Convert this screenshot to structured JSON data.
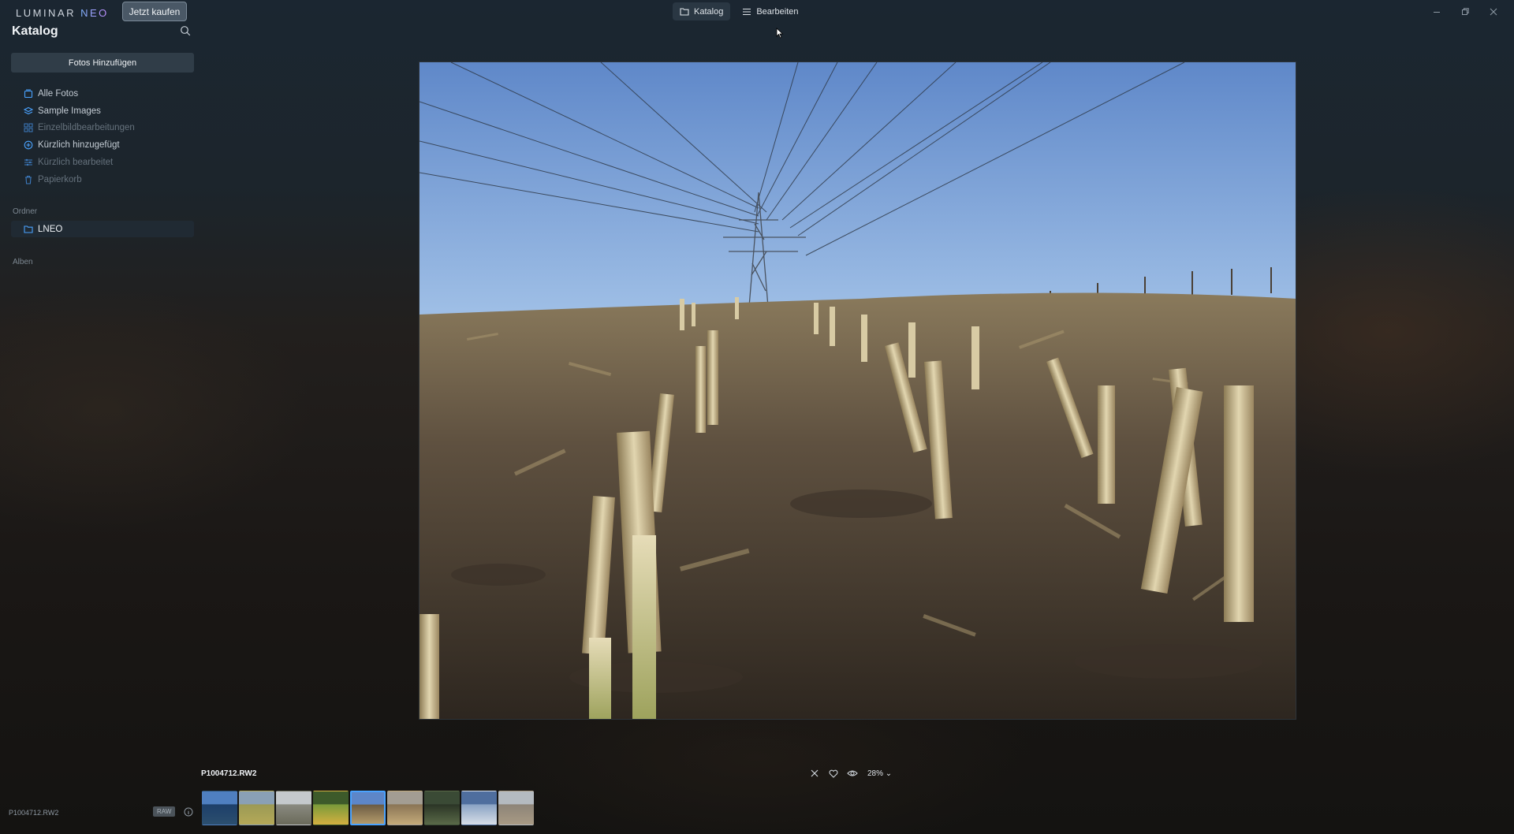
{
  "app": {
    "logo_main": "LUMINAR ",
    "logo_accent": "NEO",
    "buy_button": "Jetzt kaufen"
  },
  "mode_tabs": [
    {
      "label": "Katalog",
      "icon": "folder-icon",
      "active": true
    },
    {
      "label": "Bearbeiten",
      "icon": "sliders-icon",
      "active": false
    }
  ],
  "window_controls": [
    "minimize-icon",
    "restore-icon",
    "close-icon"
  ],
  "sidebar": {
    "title": "Katalog",
    "add_photos": "Fotos Hinzufügen",
    "items": [
      {
        "label": "Alle Fotos",
        "icon": "photos-icon",
        "enabled": true
      },
      {
        "label": "Sample Images",
        "icon": "layers-icon",
        "enabled": true
      },
      {
        "label": "Einzelbildbearbeitungen",
        "icon": "grid-icon",
        "enabled": false
      },
      {
        "label": "Kürzlich hinzugefügt",
        "icon": "plus-circle-icon",
        "enabled": true
      },
      {
        "label": "Kürzlich bearbeitet",
        "icon": "sliders-icon",
        "enabled": false
      },
      {
        "label": "Papierkorb",
        "icon": "trash-icon",
        "enabled": false
      }
    ],
    "folders_label": "Ordner",
    "folders": [
      {
        "label": "LNEO",
        "icon": "folder-icon",
        "selected": true
      }
    ],
    "albums_label": "Alben"
  },
  "viewer": {
    "file_name": "P1004712.RW2",
    "zoom": "28%",
    "tools": [
      "reject-icon",
      "favorite-icon",
      "eye-icon"
    ]
  },
  "filmstrip": {
    "selected_index": 4,
    "thumbnails": [
      {
        "name": "lake-landscape",
        "colors": [
          "#4f7fc0",
          "#1d3f6a",
          "#2c4f6e"
        ]
      },
      {
        "name": "meadow-field",
        "colors": [
          "#8aa0b5",
          "#9c9a55",
          "#b4a958"
        ]
      },
      {
        "name": "tree-field",
        "colors": [
          "#c5c9cc",
          "#8a8a80",
          "#6a6a5a"
        ]
      },
      {
        "name": "green-plant",
        "colors": [
          "#3d5a2a",
          "#7a9a3a",
          "#d4b040"
        ]
      },
      {
        "name": "stubble-field",
        "colors": [
          "#5d86c8",
          "#6b5b44",
          "#b49b6a"
        ]
      },
      {
        "name": "stubble-closeup",
        "colors": [
          "#a39d93",
          "#8a7455",
          "#c4ab7a"
        ]
      },
      {
        "name": "forest-trees",
        "colors": [
          "#3a4a35",
          "#2b3526",
          "#5a6a48"
        ]
      },
      {
        "name": "sky-clouds",
        "colors": [
          "#4f6e9e",
          "#8aa3c4",
          "#d7dee7"
        ]
      },
      {
        "name": "dry-field",
        "colors": [
          "#b4bac0",
          "#8d8478",
          "#a89a84"
        ]
      }
    ]
  },
  "status_bar": {
    "file_name": "P1004712.RW2",
    "badge": "RAW"
  }
}
